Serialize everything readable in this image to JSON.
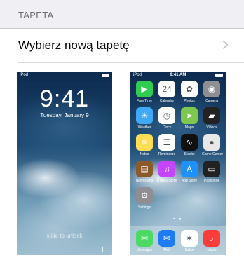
{
  "section": {
    "header": "TAPETA"
  },
  "row": {
    "label": "Wybierz nową tapetę"
  },
  "lock": {
    "carrier": "iPod",
    "time": "9:41",
    "date": "Tuesday, January 9",
    "slide": "slide to unlock"
  },
  "home": {
    "carrier": "iPod",
    "time": "9:41 AM",
    "apps": [
      {
        "label": "FaceTime",
        "icon": "facetime-icon",
        "color": "#2ecc4f",
        "glyph": "▶"
      },
      {
        "label": "Calendar",
        "icon": "calendar-icon",
        "color": "#ffffff",
        "glyph": "24"
      },
      {
        "label": "Photos",
        "icon": "photos-icon",
        "color": "#ffffff",
        "glyph": "✿"
      },
      {
        "label": "Camera",
        "icon": "camera-icon",
        "color": "#8e8e93",
        "glyph": "◉"
      },
      {
        "label": "Weather",
        "icon": "weather-icon",
        "color": "#3fa9f5",
        "glyph": "☀"
      },
      {
        "label": "Clock",
        "icon": "clock-icon",
        "color": "#ffffff",
        "glyph": "◷"
      },
      {
        "label": "Maps",
        "icon": "maps-icon",
        "color": "#7ec850",
        "glyph": "➤"
      },
      {
        "label": "Videos",
        "icon": "videos-icon",
        "color": "#222222",
        "glyph": "▰"
      },
      {
        "label": "Notes",
        "icon": "notes-icon",
        "color": "#ffdd55",
        "glyph": "≡"
      },
      {
        "label": "Reminders",
        "icon": "reminders-icon",
        "color": "#ffffff",
        "glyph": "☰"
      },
      {
        "label": "Stocks",
        "icon": "stocks-icon",
        "color": "#111111",
        "glyph": "∿"
      },
      {
        "label": "Game Center",
        "icon": "game-center-icon",
        "color": "#e8e8e8",
        "glyph": "●"
      },
      {
        "label": "Newsstand",
        "icon": "newsstand-icon",
        "color": "#8b5a2b",
        "glyph": "▤"
      },
      {
        "label": "iTunes Store",
        "icon": "itunes-store-icon",
        "color": "#c644fc",
        "glyph": "♫"
      },
      {
        "label": "App Store",
        "icon": "app-store-icon",
        "color": "#1e90ff",
        "glyph": "A"
      },
      {
        "label": "Passbook",
        "icon": "passbook-icon",
        "color": "#222222",
        "glyph": "▭"
      },
      {
        "label": "Settings",
        "icon": "settings-icon",
        "color": "#8e8e93",
        "glyph": "⚙"
      }
    ],
    "dock": [
      {
        "label": "Messages",
        "icon": "messages-icon",
        "color": "#4cd964",
        "glyph": "✉"
      },
      {
        "label": "Mail",
        "icon": "mail-icon",
        "color": "#1d7cf2",
        "glyph": "✉"
      },
      {
        "label": "Safari",
        "icon": "safari-icon",
        "color": "#ffffff",
        "glyph": "✶"
      },
      {
        "label": "Music",
        "icon": "music-icon",
        "color": "#fc3d39",
        "glyph": "♪"
      }
    ]
  }
}
